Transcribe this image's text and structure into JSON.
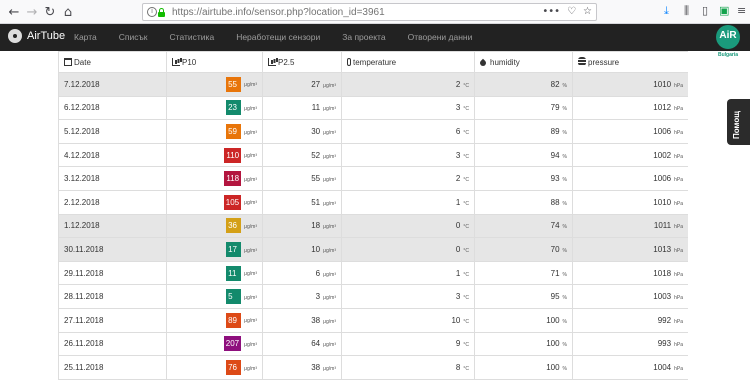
{
  "browser": {
    "url_prefix": "https://airtube.info",
    "url_path": "/sensor.php?location_id=3961",
    "more_label": "•••"
  },
  "app": {
    "brand": "AirTube",
    "menu": [
      "Карта",
      "Списък",
      "Статистика",
      "Неработещи сензори",
      "За проекта",
      "Отворени данни"
    ],
    "corner_logo": "AiR",
    "corner_sub": "Bulgaria",
    "help_label": "Помощ"
  },
  "table": {
    "headers": [
      "Date",
      "P10",
      "P2.5",
      "temperature",
      "humidity",
      "pressure"
    ],
    "pm_unit": "μg/m³",
    "temp_unit": "°C",
    "hum_unit": "%",
    "press_unit": "hPa",
    "rows": [
      {
        "date": "7.12.2018",
        "p10": "55",
        "p10_color": "#e8750a",
        "p25": "27",
        "temp": "2",
        "hum": "82",
        "press": "1010",
        "shade": true
      },
      {
        "date": "6.12.2018",
        "p10": "23",
        "p10_color": "#138a6c",
        "p25": "11",
        "temp": "3",
        "hum": "79",
        "press": "1012",
        "shade": false
      },
      {
        "date": "5.12.2018",
        "p10": "59",
        "p10_color": "#e8750a",
        "p25": "30",
        "temp": "6",
        "hum": "89",
        "press": "1006",
        "shade": false
      },
      {
        "date": "4.12.2018",
        "p10": "110",
        "p10_color": "#cc2626",
        "p25": "52",
        "temp": "3",
        "hum": "94",
        "press": "1002",
        "shade": false
      },
      {
        "date": "3.12.2018",
        "p10": "118",
        "p10_color": "#b3153f",
        "p25": "55",
        "temp": "2",
        "hum": "93",
        "press": "1006",
        "shade": false
      },
      {
        "date": "2.12.2018",
        "p10": "105",
        "p10_color": "#cc2626",
        "p25": "51",
        "temp": "1",
        "hum": "88",
        "press": "1010",
        "shade": false
      },
      {
        "date": "1.12.2018",
        "p10": "36",
        "p10_color": "#d4a017",
        "p25": "18",
        "temp": "0",
        "hum": "74",
        "press": "1011",
        "shade": true
      },
      {
        "date": "30.11.2018",
        "p10": "17",
        "p10_color": "#138a6c",
        "p25": "10",
        "temp": "0",
        "hum": "70",
        "press": "1013",
        "shade": true
      },
      {
        "date": "29.11.2018",
        "p10": "11",
        "p10_color": "#138a6c",
        "p25": "6",
        "temp": "1",
        "hum": "71",
        "press": "1018",
        "shade": false
      },
      {
        "date": "28.11.2018",
        "p10": "5",
        "p10_color": "#138a6c",
        "p25": "3",
        "temp": "3",
        "hum": "95",
        "press": "1003",
        "shade": false
      },
      {
        "date": "27.11.2018",
        "p10": "89",
        "p10_color": "#dd4a17",
        "p25": "38",
        "temp": "10",
        "hum": "100",
        "press": "992",
        "shade": false
      },
      {
        "date": "26.11.2018",
        "p10": "207",
        "p10_color": "#8e0f7d",
        "p25": "64",
        "temp": "9",
        "hum": "100",
        "press": "993",
        "shade": false
      },
      {
        "date": "25.11.2018",
        "p10": "76",
        "p10_color": "#dd4a17",
        "p25": "38",
        "temp": "8",
        "hum": "100",
        "press": "1004",
        "shade": false
      }
    ]
  }
}
